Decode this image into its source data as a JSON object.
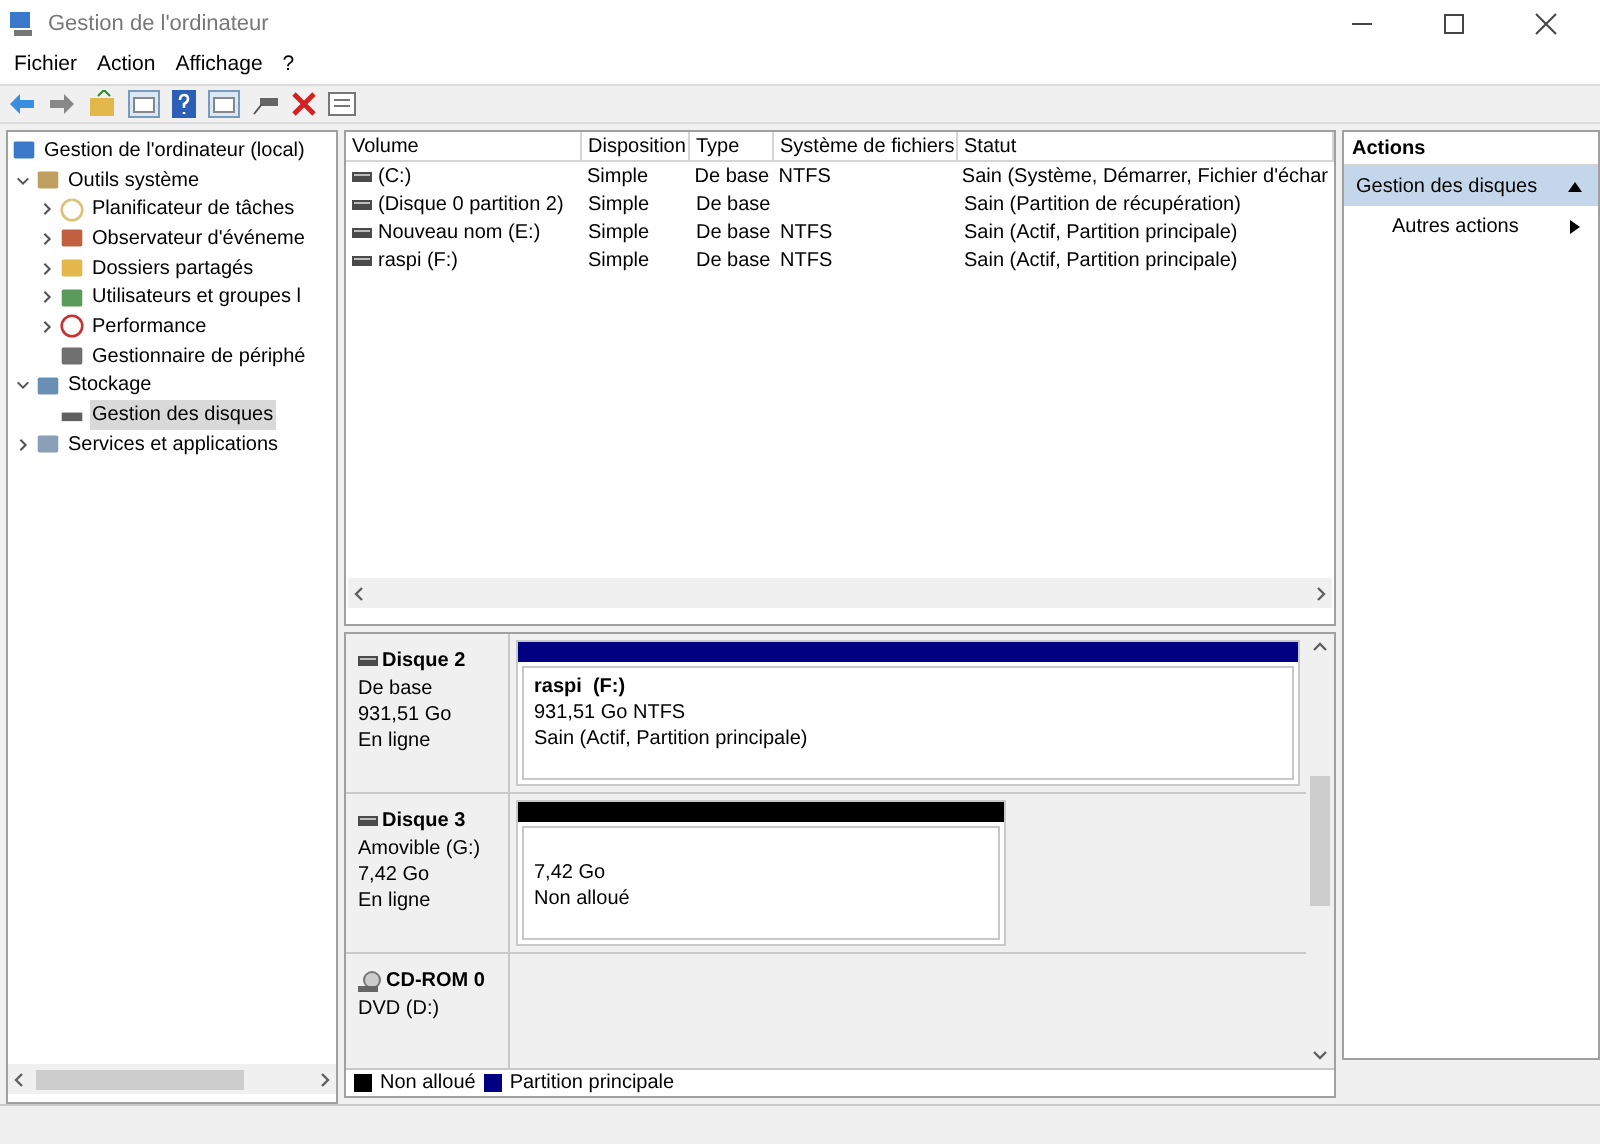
{
  "window": {
    "title": "Gestion de l'ordinateur"
  },
  "menu": [
    "Fichier",
    "Action",
    "Affichage",
    "?"
  ],
  "tree": [
    {
      "label": "Gestion de l'ordinateur (local)",
      "kind": "root",
      "selected": false,
      "children": [
        {
          "label": "Outils système",
          "kind": "branch",
          "expanded": true,
          "selected": false,
          "children": [
            {
              "label": "Planificateur de tâches",
              "kind": "branch",
              "expanded": false,
              "selected": false
            },
            {
              "label": "Observateur d'événeme",
              "kind": "branch",
              "expanded": false,
              "selected": false
            },
            {
              "label": "Dossiers partagés",
              "kind": "branch",
              "expanded": false,
              "selected": false
            },
            {
              "label": "Utilisateurs et groupes l",
              "kind": "branch",
              "expanded": false,
              "selected": false
            },
            {
              "label": "Performance",
              "kind": "branch",
              "expanded": false,
              "selected": false
            },
            {
              "label": "Gestionnaire de périphé",
              "kind": "leaf",
              "selected": false
            }
          ]
        },
        {
          "label": "Stockage",
          "kind": "branch",
          "expanded": true,
          "selected": false,
          "children": [
            {
              "label": "Gestion des disques",
              "kind": "leaf",
              "selected": true
            }
          ]
        },
        {
          "label": "Services et applications",
          "kind": "branch",
          "expanded": false,
          "selected": false
        }
      ]
    }
  ],
  "volumes": {
    "columns": [
      "Volume",
      "Disposition",
      "Type",
      "Système de fichiers",
      "Statut"
    ],
    "rows": [
      [
        "(C:)",
        "Simple",
        "De base",
        "NTFS",
        "Sain (Système, Démarrer, Fichier d'échar"
      ],
      [
        "(Disque 0 partition 2)",
        "Simple",
        "De base",
        "",
        "Sain (Partition de récupération)"
      ],
      [
        "Nouveau nom (E:)",
        "Simple",
        "De base",
        "NTFS",
        "Sain (Actif, Partition principale)"
      ],
      [
        "raspi (F:)",
        "Simple",
        "De base",
        "NTFS",
        "Sain (Actif, Partition principale)"
      ]
    ]
  },
  "disks": [
    {
      "name": "Disque 2",
      "kind": "disk",
      "info": [
        "De base",
        "931,51 Go",
        "En ligne"
      ],
      "partitions": [
        {
          "kind": "primary",
          "title": "raspi  (F:)",
          "lines": [
            "931,51 Go NTFS",
            "Sain (Actif, Partition principale)"
          ]
        }
      ]
    },
    {
      "name": "Disque 3",
      "kind": "disk",
      "info": [
        "Amovible (G:)",
        "7,42 Go",
        "En ligne"
      ],
      "partitions": [
        {
          "kind": "unallocated",
          "lines": [
            "7,42 Go",
            "Non alloué"
          ]
        }
      ]
    },
    {
      "name": "CD-ROM 0",
      "kind": "cdrom",
      "info": [
        "DVD (D:)"
      ]
    }
  ],
  "legend": [
    {
      "label": "Non alloué",
      "color": "#000000"
    },
    {
      "label": "Partition principale",
      "color": "#000080"
    }
  ],
  "actions": {
    "title": "Actions",
    "items": [
      {
        "label": "Gestion des disques",
        "kind": "section",
        "expanded": true
      },
      {
        "label": "Autres actions",
        "kind": "submenu"
      }
    ]
  }
}
